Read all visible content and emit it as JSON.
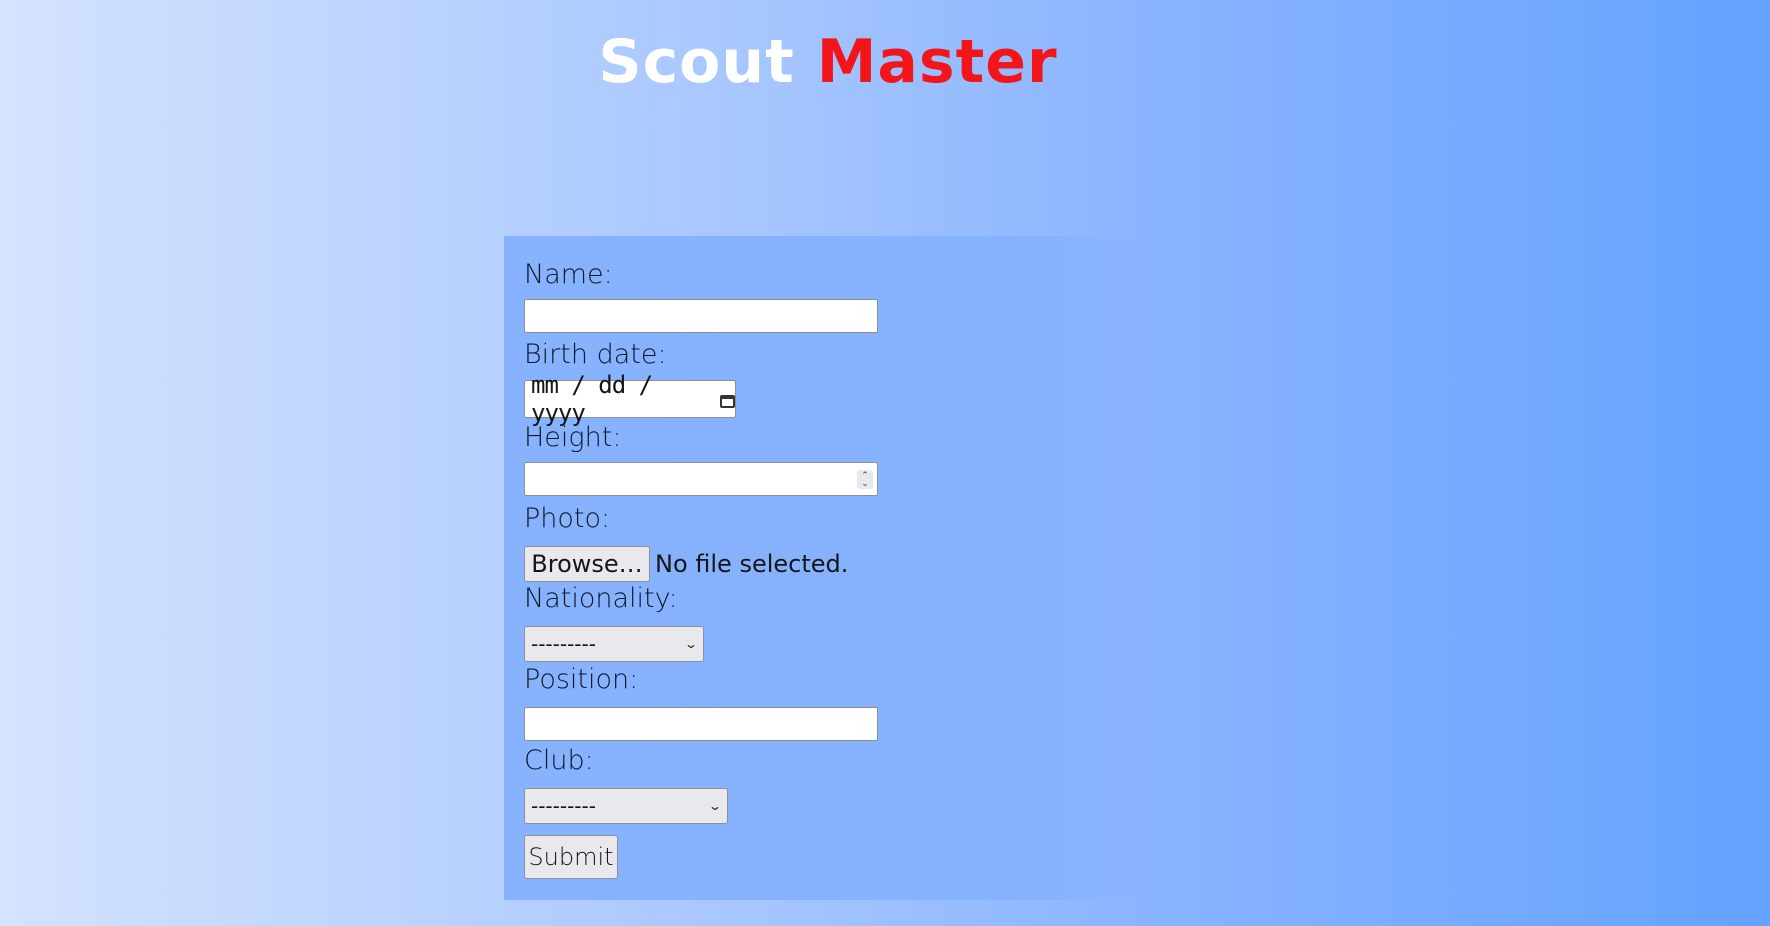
{
  "header": {
    "title_part1": "Scout",
    "title_part2": "Master",
    "title_color1": "#ffffff",
    "title_color2": "#f4151b"
  },
  "form": {
    "name_label": "Name:",
    "name_value": "",
    "birth_date_label": "Birth date:",
    "birth_date_placeholder": "mm / dd / yyyy",
    "height_label": "Height:",
    "height_value": "",
    "photo_label": "Photo:",
    "browse_label": "Browse…",
    "file_status": "No file selected.",
    "nationality_label": "Nationality:",
    "nationality_selected": "---------",
    "position_label": "Position:",
    "position_value": "",
    "club_label": "Club:",
    "club_selected": "---------",
    "submit_label": "Submit"
  },
  "colors": {
    "panel_bg": "#87b2fd",
    "bg_left": "#d4e3fe",
    "bg_right": "#64a2ff"
  }
}
